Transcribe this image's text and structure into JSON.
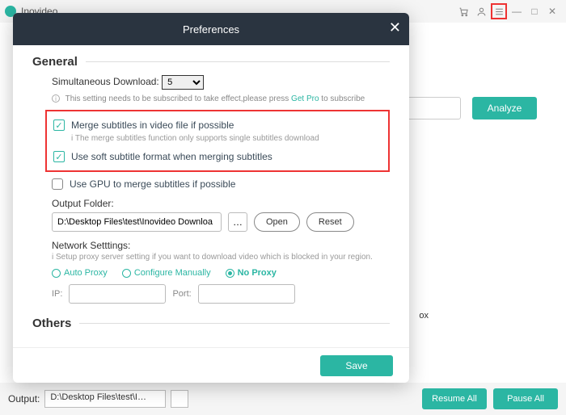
{
  "topbar": {
    "title": "Inovideo"
  },
  "background": {
    "analyze": "Analyze",
    "ox": "ox",
    "output_label": "Output:",
    "output_path": "D:\\Desktop Files\\test\\I…",
    "resume": "Resume All",
    "pause": "Pause All"
  },
  "dialog": {
    "title": "Preferences",
    "general": {
      "heading": "General",
      "sim_label": "Simultaneous Download:",
      "sim_value": "5",
      "sim_hint_a": "This setting needs to be subscribed to take effect,please press ",
      "sim_hint_link": "Get Pro",
      "sim_hint_b": " to subscribe",
      "merge_label": "Merge subtitles in video file if possible",
      "merge_hint": "The merge subtitles function only supports single subtitles download",
      "soft_label": "Use soft subtitle format when merging subtitles",
      "gpu_label": "Use GPU to merge subtitles if possible",
      "output_folder_label": "Output Folder:",
      "output_folder_value": "D:\\Desktop Files\\test\\Inovideo Downloa",
      "open": "Open",
      "reset": "Reset",
      "network_label": "Network Setttings:",
      "network_hint": "Setup proxy server setting if you want to download video which is blocked in your region.",
      "radio_auto": "Auto Proxy",
      "radio_manual": "Configure Manually",
      "radio_none": "No Proxy",
      "ip_label": "IP:",
      "port_label": "Port:"
    },
    "others_heading": "Others",
    "save": "Save"
  }
}
